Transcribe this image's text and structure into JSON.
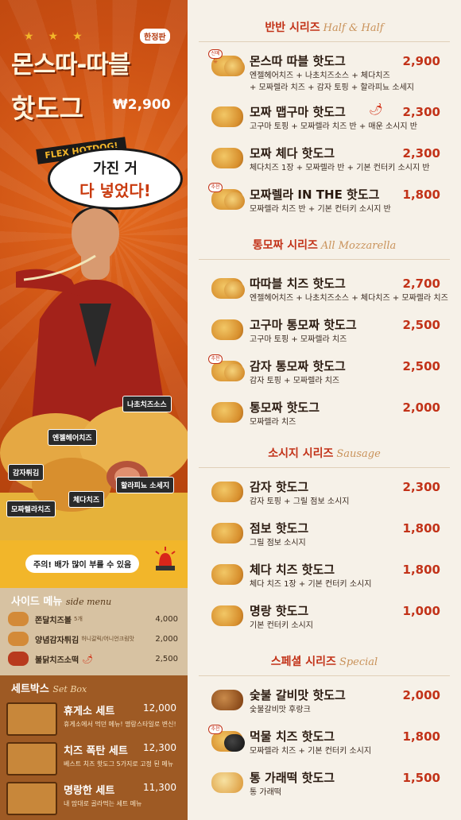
{
  "hero": {
    "edition": "한정판",
    "title_line1": "몬스따-따블",
    "title_line2": "핫도그",
    "price": "₩2,900",
    "flex_tag": "FLEX HOTDOG!",
    "bubble_line1": "가진 거",
    "bubble_line2": "다 넣었다!",
    "food_labels": [
      "나초치즈소스",
      "엔젤헤어치즈",
      "감자튀김",
      "할라피뇨 소세지",
      "체다치즈",
      "모짜렐라치즈"
    ],
    "warning": "주의! 배가 많이 부를 수 있음"
  },
  "side_menu": {
    "title": "사이드 메뉴",
    "title_en": "side menu",
    "items": [
      {
        "name": "쫀달치즈볼",
        "sub": "5개",
        "price": "4,000"
      },
      {
        "name": "양념감자튀김",
        "sub": "허니갈릭/어니언크림맛",
        "price": "2,000"
      },
      {
        "name": "불닭치즈소떡",
        "sub": "",
        "price": "2,500"
      }
    ]
  },
  "set_box": {
    "title": "세트박스",
    "title_en": "Set Box",
    "items": [
      {
        "name": "휴게소 세트",
        "price": "12,000",
        "desc": "휴게소에서 먹던 메뉴! 명랑스타일로 변신!"
      },
      {
        "name": "치즈 폭탄 세트",
        "price": "12,300",
        "desc": "베스트 치즈 핫도그 5가지로 고정 된 메뉴"
      },
      {
        "name": "명랑한 세트",
        "price": "11,300",
        "desc": "내 맘대로 골라먹는 세트 메뉴"
      }
    ]
  },
  "sections": [
    {
      "title": "반반 시리즈",
      "title_en": "Half & Half",
      "items": [
        {
          "name": "몬스따 따블 핫도그",
          "price": "2,900",
          "desc": "엔젤헤어치즈 + 나초치즈소스 + 체다치즈\n+ 모짜렐라 치즈 + 감자 토핑 + 할라피뇨 소세지"
        },
        {
          "name": "모짜 맵구마 핫도그",
          "price": "2,300",
          "desc": "고구마 토핑 + 모짜렐라 치즈 반 + 매운 소시지 반"
        },
        {
          "name": "모짜 체다 핫도그",
          "price": "2,300",
          "desc": "체다치즈 1장 + 모짜렐라 반 + 기본 컨터키 소시지 반"
        },
        {
          "name": "모짜렐라 IN THE 핫도그",
          "price": "1,800",
          "desc": "모짜렐라 치즈 반 + 기본 컨터키 소시지 반"
        }
      ]
    },
    {
      "title": "통모짜 시리즈",
      "title_en": "All Mozzarella",
      "items": [
        {
          "name": "따따블 치즈 핫도그",
          "price": "2,700",
          "desc": "엔젤헤어치즈 + 나초치즈소스 + 체다치즈 + 모짜렐라 치즈"
        },
        {
          "name": "고구마 통모짜 핫도그",
          "price": "2,500",
          "desc": "고구마 토핑 + 모짜렐라 치즈"
        },
        {
          "name": "감자 통모짜 핫도그",
          "price": "2,500",
          "desc": "감자 토핑 + 모짜렐라 치즈"
        },
        {
          "name": "통모짜 핫도그",
          "price": "2,000",
          "desc": "모짜렐라 치즈"
        }
      ]
    },
    {
      "title": "소시지 시리즈",
      "title_en": "Sausage",
      "items": [
        {
          "name": "감자 핫도그",
          "price": "2,300",
          "desc": "감자 토핑 + 그릴 점보 소시지"
        },
        {
          "name": "점보 핫도그",
          "price": "1,800",
          "desc": "그릴 점보 소시지"
        },
        {
          "name": "체다 치즈 핫도그",
          "price": "1,800",
          "desc": "체다 치즈 1장 + 기본 컨터키 소시지"
        },
        {
          "name": "명랑 핫도그",
          "price": "1,000",
          "desc": "기본 컨터키 소시지"
        }
      ]
    },
    {
      "title": "스페셜 시리즈",
      "title_en": "Special",
      "items": [
        {
          "name": "숯불 갈비맛 핫도그",
          "price": "2,000",
          "desc": "숯불갈비맛 후랑크"
        },
        {
          "name": "먹물 치즈 핫도그",
          "price": "1,800",
          "desc": "모짜렐라 치즈 + 기본 컨터키 소시지"
        },
        {
          "name": "통 가래떡 핫도그",
          "price": "1,500",
          "desc": "통 가래떡"
        }
      ]
    }
  ],
  "badges": {
    "new": "신메뉴",
    "best": "추천"
  },
  "colors": {
    "accent_red": "#c23218",
    "hero_orange": "#c94e12",
    "gold": "#f2b62a",
    "set_brown": "#9e5a24",
    "side_tan": "#d7c2a2"
  }
}
